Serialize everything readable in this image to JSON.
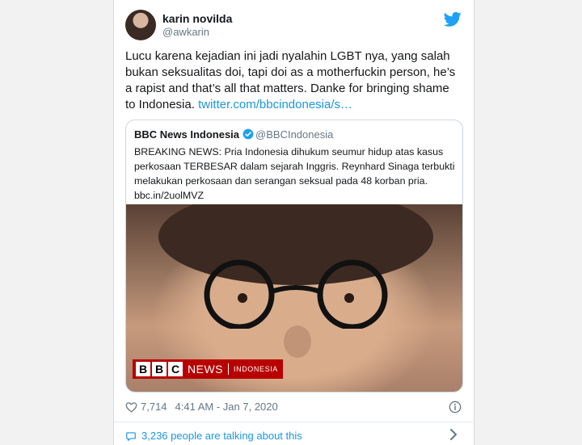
{
  "tweet": {
    "author_name": "karin novilda",
    "author_handle": "@awkarin",
    "text": "Lucu karena kejadian ini jadi nyalahin LGBT nya, yang salah bukan seksualitas doi, tapi doi as a motherfuckin person, he’s a rapist and that’s all that matters. Danke for bringing shame to Indonesia.",
    "link": "twitter.com/bbcindonesia/s…",
    "likes": "7,714",
    "timestamp": "4:41 AM - Jan 7, 2020",
    "talking": "3,236 people are talking about this"
  },
  "quote": {
    "name": "BBC News Indonesia",
    "handle": "@BBCIndonesia",
    "text": "BREAKING NEWS: Pria Indonesia dihukum seumur hidup atas kasus perkosaan TERBESAR dalam sejarah Inggris. Reynhard Sinaga terbukti melakukan perkosaan dan serangan seksual pada 48 korban pria. bbc.in/2uolMVZ",
    "logo_letters": [
      "B",
      "B",
      "C"
    ],
    "logo_news": "NEWS",
    "logo_region": "INDONESIA"
  },
  "colors": {
    "link": "#1b95e0",
    "bbc_red": "#b80000",
    "muted": "#657786"
  },
  "icons": [
    "twitter-bird-icon",
    "verified-badge-icon",
    "heart-icon",
    "info-icon",
    "comment-bubble-icon",
    "chevron-right-icon"
  ]
}
